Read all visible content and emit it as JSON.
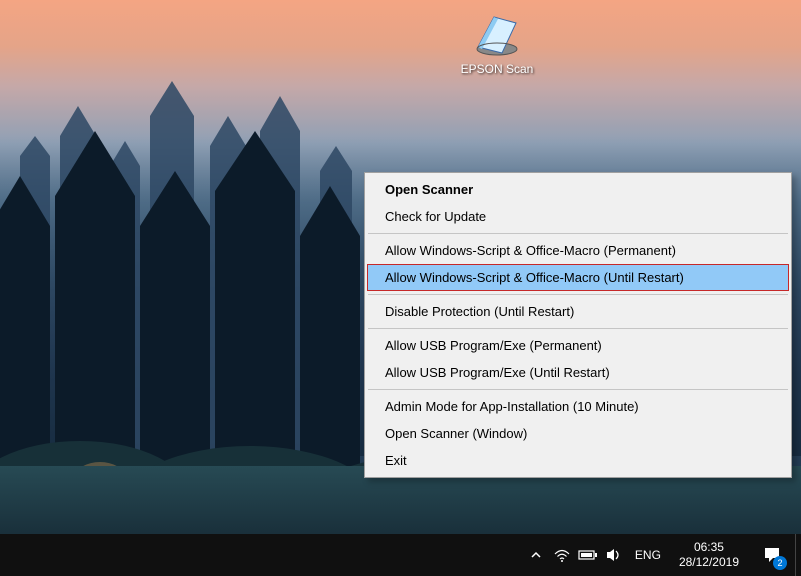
{
  "desktop_icon": {
    "label": "EPSON Scan"
  },
  "context_menu": {
    "items": [
      {
        "label": "Open Scanner",
        "bold": true
      },
      {
        "label": "Check for Update"
      },
      {
        "sep": true
      },
      {
        "label": "Allow Windows-Script & Office-Macro (Permanent)"
      },
      {
        "label": "Allow Windows-Script & Office-Macro (Until Restart)",
        "highlighted": true
      },
      {
        "sep": true
      },
      {
        "label": "Disable Protection (Until Restart)"
      },
      {
        "sep": true
      },
      {
        "label": "Allow USB Program/Exe (Permanent)"
      },
      {
        "label": "Allow USB Program/Exe (Until Restart)"
      },
      {
        "sep": true
      },
      {
        "label": "Admin Mode for App-Installation (10 Minute)"
      },
      {
        "label": "Open Scanner (Window)"
      },
      {
        "label": "Exit"
      }
    ]
  },
  "taskbar": {
    "lang": "ENG",
    "time": "06:35",
    "date": "28/12/2019",
    "notif_count": "2"
  }
}
